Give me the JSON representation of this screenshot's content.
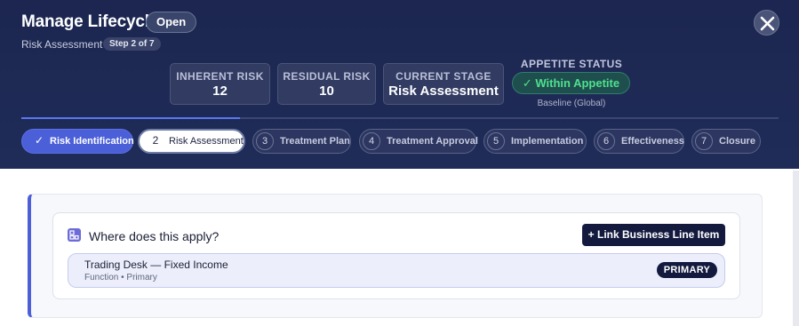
{
  "header": {
    "title": "Manage Lifecycle",
    "status": "Open",
    "subtitle": "Risk Assessment",
    "step_indicator": "Step 2 of 7"
  },
  "metrics": [
    {
      "label": "INHERENT RISK",
      "value": "12"
    },
    {
      "label": "RESIDUAL RISK",
      "value": "10"
    },
    {
      "label": "CURRENT STAGE",
      "value": "Risk Assessment"
    }
  ],
  "appetite": {
    "label": "APPETITE STATUS",
    "status": "✓ Within Appetite",
    "baseline": "Baseline (Global)",
    "status_color": "#4ee08e"
  },
  "progress": {
    "completed_fraction": 0.29
  },
  "steps": [
    {
      "num": "✓",
      "label": "Risk Identification",
      "state": "done"
    },
    {
      "num": "2",
      "label": "Risk Assessment",
      "state": "active"
    },
    {
      "num": "3",
      "label": "Treatment Plan",
      "state": "pending"
    },
    {
      "num": "4",
      "label": "Treatment Approval",
      "state": "pending"
    },
    {
      "num": "5",
      "label": "Implementation",
      "state": "pending"
    },
    {
      "num": "6",
      "label": "Effectiveness",
      "state": "pending"
    },
    {
      "num": "7",
      "label": "Closure",
      "state": "pending"
    }
  ],
  "applies": {
    "title": "Where does this apply?",
    "link_button": "+ Link Business Line Item",
    "items": [
      {
        "name": "Trading Desk — Fixed Income",
        "meta": "Function • Primary",
        "badge": "PRIMARY"
      }
    ]
  },
  "colors": {
    "header_bg": "#1e2a55",
    "accent": "#4c5fd8",
    "dark_button": "#131a3e"
  }
}
